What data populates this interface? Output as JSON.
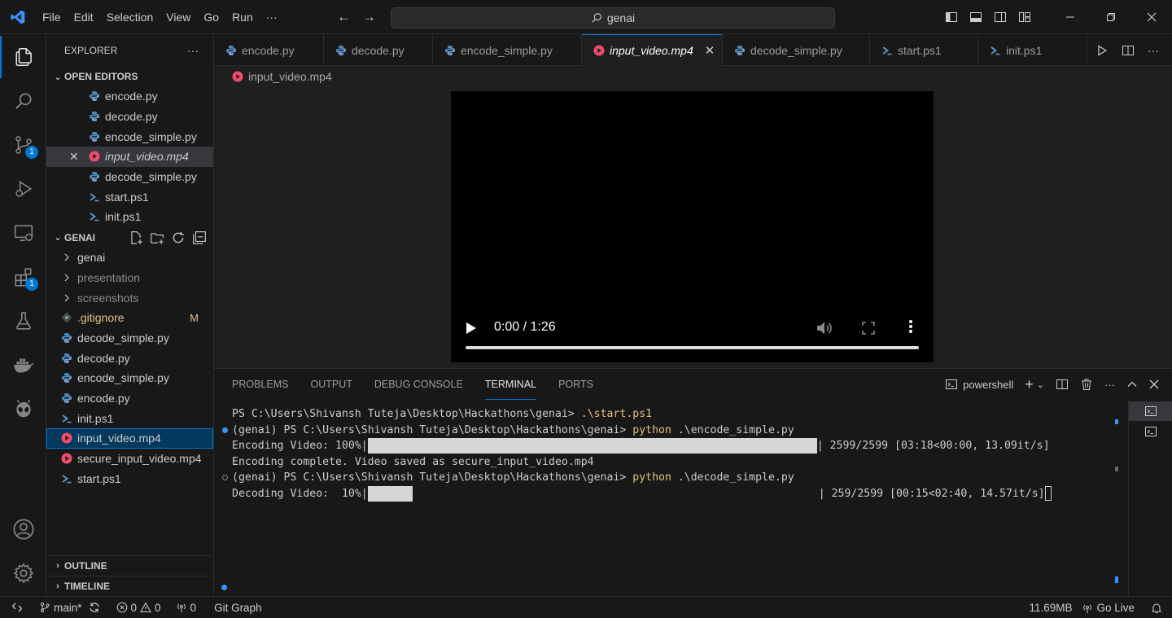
{
  "titlebar": {
    "menu": [
      "File",
      "Edit",
      "Selection",
      "View",
      "Go",
      "Run",
      "···"
    ],
    "search_text": "genai"
  },
  "activity": {
    "scm_badge": "1",
    "extensions_badge": "1"
  },
  "sidebar": {
    "title": "EXPLORER",
    "more": "···",
    "open_editors_label": "OPEN EDITORS",
    "open_editors": [
      {
        "name": "encode.py",
        "icon": "python-icon"
      },
      {
        "name": "decode.py",
        "icon": "python-icon"
      },
      {
        "name": "encode_simple.py",
        "icon": "python-icon"
      },
      {
        "name": "input_video.mp4",
        "icon": "video-icon"
      },
      {
        "name": "decode_simple.py",
        "icon": "python-icon"
      },
      {
        "name": "start.ps1",
        "icon": "powershell-icon"
      },
      {
        "name": "init.ps1",
        "icon": "powershell-icon"
      }
    ],
    "workspace_label": "GENAI",
    "files": [
      {
        "name": "genai",
        "type": "folder"
      },
      {
        "name": "presentation",
        "type": "folder"
      },
      {
        "name": "screenshots",
        "type": "folder"
      },
      {
        "name": ".gitignore",
        "type": "git",
        "badge": "M"
      },
      {
        "name": "decode_simple.py",
        "type": "python"
      },
      {
        "name": "decode.py",
        "type": "python"
      },
      {
        "name": "encode_simple.py",
        "type": "python"
      },
      {
        "name": "encode.py",
        "type": "python"
      },
      {
        "name": "init.ps1",
        "type": "powershell"
      },
      {
        "name": "input_video.mp4",
        "type": "video"
      },
      {
        "name": "secure_input_video.mp4",
        "type": "video"
      },
      {
        "name": "start.ps1",
        "type": "powershell"
      }
    ],
    "outline_label": "OUTLINE",
    "timeline_label": "TIMELINE"
  },
  "tabs": [
    {
      "label": "encode.py",
      "icon": "python-icon"
    },
    {
      "label": "decode.py",
      "icon": "python-icon"
    },
    {
      "label": "encode_simple.py",
      "icon": "python-icon"
    },
    {
      "label": "input_video.mp4",
      "icon": "video-icon",
      "active": true
    },
    {
      "label": "decode_simple.py",
      "icon": "python-icon"
    },
    {
      "label": "start.ps1",
      "icon": "powershell-icon"
    },
    {
      "label": "init.ps1",
      "icon": "powershell-icon"
    }
  ],
  "breadcrumb": "input_video.mp4",
  "video": {
    "time": "0:00 / 1:26",
    "progress": 0
  },
  "panel": {
    "tabs": [
      "PROBLEMS",
      "OUTPUT",
      "DEBUG CONSOLE",
      "TERMINAL",
      "PORTS"
    ],
    "active_tab": "TERMINAL",
    "shell_label": "powershell",
    "terminal": {
      "line1_prompt": "PS C:\\Users\\Shivansh Tuteja\\Desktop\\Hackathons\\genai> ",
      "line1_cmd": ".\\start.ps1",
      "line2_prompt": "(genai) PS C:\\Users\\Shivansh Tuteja\\Desktop\\Hackathons\\genai> ",
      "line2_cmd_a": "python",
      "line2_cmd_b": " .\\encode_simple.py",
      "line3_label": "Encoding Video: 100%|",
      "line3_progress": 1.0,
      "line3_stats": "| 2599/2599 [03:18<00:00, 13.09it/s]",
      "line4": "Encoding complete. Video saved as secure_input_video.mp4",
      "line5_prompt": "(genai) PS C:\\Users\\Shivansh Tuteja\\Desktop\\Hackathons\\genai> ",
      "line5_cmd_a": "python",
      "line5_cmd_b": " .\\decode_simple.py",
      "line6_label": "Decoding Video:  10%|",
      "line6_progress": 0.1,
      "line6_stats": "| 259/2599 [00:15<02:40, 14.57it/s]"
    }
  },
  "statusbar": {
    "branch": "main*",
    "errors": "0",
    "warnings": "0",
    "ports": "0",
    "git_graph": "Git Graph",
    "memory": "11.69MB",
    "go_live": "Go Live"
  },
  "colors": {
    "accent": "#0078d4",
    "python": "#4b8bbe",
    "video": "#f14c6e",
    "powershell": "#5b9bd5",
    "git_modified": "#e2c08d",
    "terminal_yellow": "#e5c07b"
  }
}
